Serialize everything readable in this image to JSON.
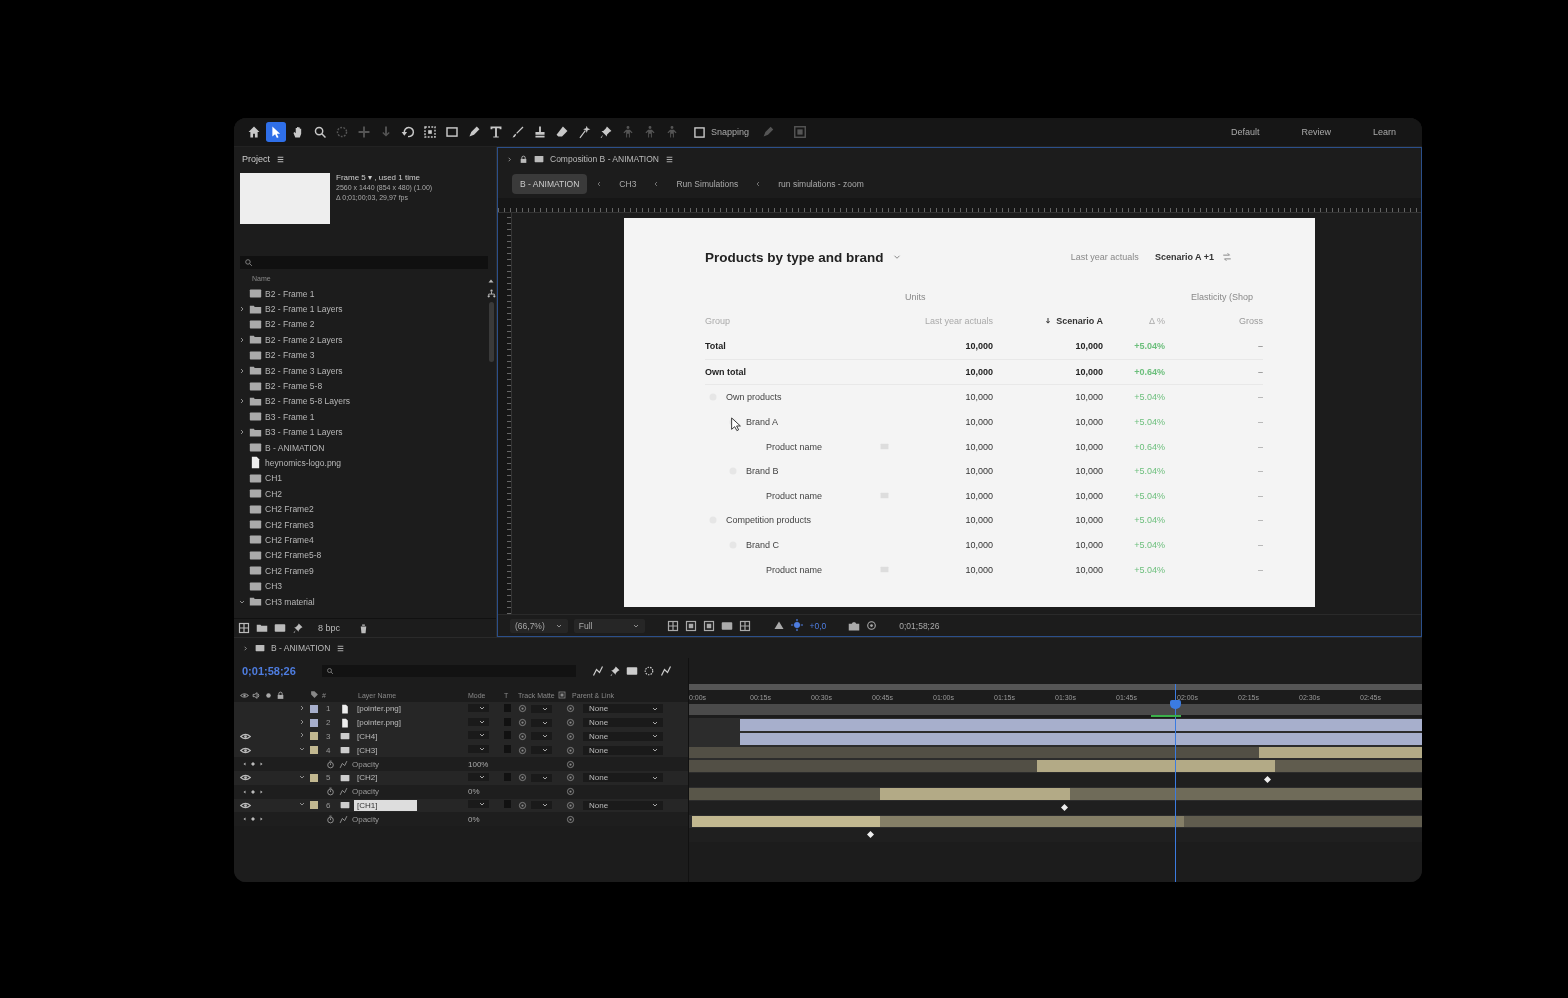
{
  "toolbar": {
    "tools": [
      {
        "kind": "home",
        "selected": false,
        "disabled": false
      },
      {
        "kind": "pointer",
        "selected": true,
        "disabled": false
      },
      {
        "kind": "hand",
        "selected": false,
        "disabled": false
      },
      {
        "kind": "zoom",
        "selected": false,
        "disabled": false
      },
      {
        "kind": "orbit",
        "selected": false,
        "disabled": true
      },
      {
        "kind": "pan",
        "selected": false,
        "disabled": true
      },
      {
        "kind": "dolly",
        "selected": false,
        "disabled": true
      },
      {
        "kind": "rotate",
        "selected": false,
        "disabled": false
      },
      {
        "kind": "region",
        "selected": false,
        "disabled": false
      },
      {
        "kind": "rectangle",
        "selected": false,
        "disabled": false
      },
      {
        "kind": "pen",
        "selected": false,
        "disabled": false
      },
      {
        "kind": "type",
        "selected": false,
        "disabled": false
      },
      {
        "kind": "brush",
        "selected": false,
        "disabled": false
      },
      {
        "kind": "stamp",
        "selected": false,
        "disabled": false
      },
      {
        "kind": "eraser",
        "selected": false,
        "disabled": false
      },
      {
        "kind": "roto",
        "selected": false,
        "disabled": false
      },
      {
        "kind": "pin",
        "selected": false,
        "disabled": false
      },
      {
        "kind": "puppet",
        "selected": false,
        "disabled": true
      },
      {
        "kind": "puppet",
        "selected": false,
        "disabled": true
      },
      {
        "kind": "puppet",
        "selected": false,
        "disabled": true
      }
    ],
    "snapping": {
      "label": "Snapping",
      "checked": false
    },
    "workspaces": [
      "Default",
      "Review",
      "Learn"
    ]
  },
  "project": {
    "title": "Project",
    "preview": {
      "name": "Frame 5 ▾ , used 1 time",
      "size": "2560 x 1440  (854 x 480) (1.00)",
      "duration": "Δ 0;01;00;03, 29,97 fps"
    },
    "name_column": "Name",
    "items": [
      {
        "kind": "comp",
        "name": "B2 - Frame 1"
      },
      {
        "kind": "folder",
        "name": "B2 - Frame 1 Layers",
        "expanded": false
      },
      {
        "kind": "comp",
        "name": "B2 - Frame 2"
      },
      {
        "kind": "folder",
        "name": "B2 - Frame 2 Layers",
        "expanded": false
      },
      {
        "kind": "comp",
        "name": "B2 - Frame 3"
      },
      {
        "kind": "folder",
        "name": "B2 - Frame 3 Layers",
        "expanded": false
      },
      {
        "kind": "comp",
        "name": "B2 - Frame 5-8"
      },
      {
        "kind": "folder",
        "name": "B2 - Frame 5-8 Layers",
        "expanded": false
      },
      {
        "kind": "comp",
        "name": "B3 - Frame 1"
      },
      {
        "kind": "folder",
        "name": "B3 - Frame 1 Layers",
        "expanded": false
      },
      {
        "kind": "comp",
        "name": "B - ANIMATION"
      },
      {
        "kind": "file",
        "name": "heynomics-logo.png"
      },
      {
        "kind": "comp",
        "name": "CH1"
      },
      {
        "kind": "comp",
        "name": "CH2"
      },
      {
        "kind": "comp",
        "name": "CH2 Frame2"
      },
      {
        "kind": "comp",
        "name": "CH2 Frame3"
      },
      {
        "kind": "comp",
        "name": "CH2 Frame4"
      },
      {
        "kind": "comp",
        "name": "CH2 Frame5-8"
      },
      {
        "kind": "comp",
        "name": "CH2 Frame9"
      },
      {
        "kind": "comp",
        "name": "CH3"
      },
      {
        "kind": "folder",
        "name": "CH3 material",
        "expanded": true
      }
    ],
    "depth": "8 bpc"
  },
  "composition": {
    "title": "Composition B - ANIMATION",
    "breadcrumbs": [
      {
        "label": "B - ANIMATION",
        "selected": true
      },
      {
        "label": "CH3",
        "selected": false
      },
      {
        "label": "Run Simulations",
        "selected": false
      },
      {
        "label": "run simulations - zoom",
        "selected": false
      }
    ],
    "card": {
      "title": "Products by type and brand",
      "compare": "Last year actuals",
      "scenario": "Scenario A +1",
      "group_headers": [
        "Units",
        "Elasticity (Shop"
      ],
      "columns": [
        {
          "label": "Group",
          "sorted": false
        },
        {
          "label": "Last year actuals",
          "sorted": false
        },
        {
          "label": "Scenario A",
          "sorted": true
        },
        {
          "label": "Δ %",
          "sorted": false
        },
        {
          "label": "Gross",
          "sorted": false
        }
      ],
      "rows": [
        {
          "kind": "total",
          "label": "Total",
          "values": [
            "10,000",
            "10,000",
            "+5.04%",
            "–"
          ]
        },
        {
          "kind": "total",
          "label": "Own total",
          "values": [
            "10,000",
            "10,000",
            "+0.64%",
            "–"
          ]
        },
        {
          "kind": "group",
          "label": "Own products",
          "values": [
            "10,000",
            "10,000",
            "+5.04%",
            "–"
          ],
          "children": [
            {
              "kind": "group",
              "label": "Brand A",
              "values": [
                "10,000",
                "10,000",
                "+5.04%",
                "–"
              ],
              "children": [
                {
                  "kind": "product",
                  "label": "Product name",
                  "values": [
                    "10,000",
                    "10,000",
                    "+0.64%",
                    "–"
                  ]
                }
              ]
            },
            {
              "kind": "group",
              "label": "Brand B",
              "values": [
                "10,000",
                "10,000",
                "+5.04%",
                "–"
              ],
              "children": [
                {
                  "kind": "product",
                  "label": "Product name",
                  "values": [
                    "10,000",
                    "10,000",
                    "+5.04%",
                    "–"
                  ]
                }
              ]
            }
          ]
        },
        {
          "kind": "group",
          "label": "Competition products",
          "values": [
            "10,000",
            "10,000",
            "+5.04%",
            "–"
          ],
          "children": [
            {
              "kind": "group",
              "label": "Brand C",
              "values": [
                "10,000",
                "10,000",
                "+5.04%",
                "–"
              ],
              "children": [
                {
                  "kind": "product",
                  "label": "Product name",
                  "values": [
                    "10,000",
                    "10,000",
                    "+5.04%",
                    "–"
                  ]
                }
              ]
            }
          ]
        }
      ]
    },
    "footer": {
      "zoom": "(66,7%)",
      "resolution": "Full",
      "exposure": "+0,0",
      "timecode": "0;01;58;26"
    }
  },
  "timeline": {
    "title": "B - ANIMATION",
    "timecode": "0;01;58;26",
    "columns": [
      "#",
      "Layer Name",
      "Mode",
      "T",
      "Track Matte",
      "Parent & Link"
    ],
    "time_labels": [
      "0:00s",
      "00:15s",
      "00:30s",
      "00:45s",
      "01:00s",
      "01:15s",
      "01:30s",
      "01:45s",
      "02:00s",
      "02:15s",
      "02:30s",
      "02:45s"
    ],
    "rows": [
      {
        "kind": "layer",
        "number": "1",
        "name": "[pointer.png]",
        "source": {
          "kind": "image"
        },
        "visible": false,
        "expanded": false,
        "selected": false,
        "color": "#a7afcc",
        "parent": "None"
      },
      {
        "kind": "layer",
        "number": "2",
        "name": "[pointer.png]",
        "source": {
          "kind": "image"
        },
        "visible": false,
        "expanded": false,
        "selected": false,
        "color": "#a7afcc",
        "parent": "None"
      },
      {
        "kind": "layer",
        "number": "3",
        "name": "[CH4]",
        "source": {
          "kind": "comp"
        },
        "visible": true,
        "expanded": false,
        "selected": false,
        "color": "#c2b890",
        "parent": "None"
      },
      {
        "kind": "layer",
        "number": "4",
        "name": "[CH3]",
        "source": {
          "kind": "comp"
        },
        "visible": true,
        "expanded": true,
        "selected": false,
        "color": "#c2b890",
        "parent": "None"
      },
      {
        "kind": "property",
        "name": "Opacity",
        "value": "100%"
      },
      {
        "kind": "layer",
        "number": "5",
        "name": "[CH2]",
        "source": {
          "kind": "comp"
        },
        "visible": true,
        "expanded": true,
        "selected": false,
        "color": "#c2b890",
        "parent": "None"
      },
      {
        "kind": "property",
        "name": "Opacity",
        "value": "0%"
      },
      {
        "kind": "layer",
        "number": "6",
        "name": "[CH1]",
        "source": {
          "kind": "comp"
        },
        "visible": true,
        "expanded": true,
        "selected": true,
        "color": "#c2b890",
        "parent": "None"
      },
      {
        "kind": "property",
        "name": "Opacity",
        "value": "0%"
      }
    ]
  }
}
